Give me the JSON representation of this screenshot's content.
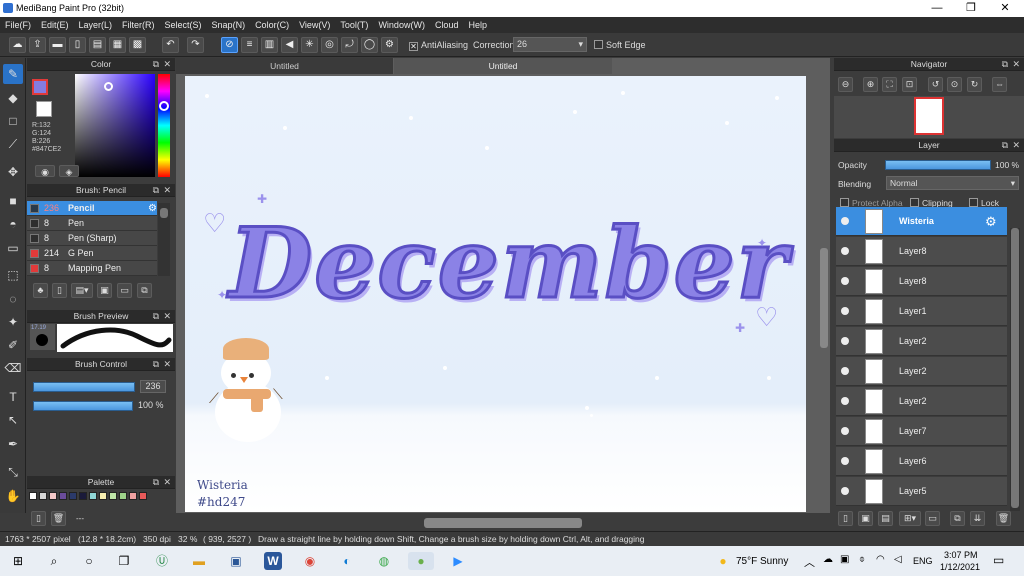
{
  "window": {
    "title": "MediBang Paint Pro (32bit)"
  },
  "menu": [
    "File(F)",
    "Edit(E)",
    "Layer(L)",
    "Filter(R)",
    "Select(S)",
    "Snap(N)",
    "Color(C)",
    "View(V)",
    "Tool(T)",
    "Window(W)",
    "Cloud",
    "Help"
  ],
  "toolbar": {
    "antialiasing_label": "AntiAliasing",
    "correction_label": "Correction",
    "correction_value": "26",
    "soft_edge_label": "Soft Edge"
  },
  "color_panel": {
    "title": "Color",
    "r": "R:132",
    "g": "G:124",
    "b": "B:226",
    "hex": "#847CE2",
    "primary_color": "#847CE2"
  },
  "brush_panel": {
    "title": "Brush: Pencil",
    "items": [
      {
        "size": "236",
        "name": "Pencil",
        "color": "#2a3a4a"
      },
      {
        "size": "8",
        "name": "Pen",
        "color": "#2e2e2e"
      },
      {
        "size": "8",
        "name": "Pen (Sharp)",
        "color": "#2e2e2e"
      },
      {
        "size": "214",
        "name": "G Pen",
        "color": "#e03a3a"
      },
      {
        "size": "8",
        "name": "Mapping Pen",
        "color": "#e03a3a"
      }
    ]
  },
  "brush_preview": {
    "title": "Brush Preview",
    "size": "17.19"
  },
  "brush_control": {
    "title": "Brush Control",
    "size_value": "236",
    "opacity_value": "100 %"
  },
  "palette": {
    "title": "Palette",
    "colors": [
      "#ffffff",
      "#d8d8d8",
      "#f4c8c8",
      "#6b4c9a",
      "#2b3a6b",
      "#1a1a3a",
      "#8fd6d6",
      "#f8efb0",
      "#bfe6a8",
      "#9ed38a",
      "#f0a0a0",
      "#e85a5a"
    ],
    "footer": "---"
  },
  "tabs": [
    "Untitled",
    "Untitled"
  ],
  "artwork": {
    "headline": "December",
    "signature_name": "Wisteria",
    "signature_tag": "#hd247"
  },
  "navigator": {
    "title": "Navigator"
  },
  "layer_panel": {
    "title": "Layer",
    "opacity_label": "Opacity",
    "opacity_value": "100 %",
    "opacity_fraction": 1.0,
    "blending_label": "Blending",
    "blending_value": "Normal",
    "protect_alpha_label": "Protect Alpha",
    "clipping_label": "Clipping",
    "lock_label": "Lock",
    "layers": [
      "Wisteria",
      "Layer8",
      "Layer8",
      "Layer1",
      "Layer2",
      "Layer2",
      "Layer2",
      "Layer7",
      "Layer6",
      "Layer5"
    ]
  },
  "statusbar": {
    "size": "1763 * 2507 pixel",
    "physical": "(12.8 * 18.2cm)",
    "dpi": "350 dpi",
    "zoom": "32 %",
    "coords": "( 939, 2527 )",
    "hint": "Draw a straight line by holding down Shift, Change a brush size by holding down Ctrl, Alt, and dragging"
  },
  "taskbar": {
    "weather": "75°F  Sunny",
    "language": "ENG",
    "time": "3:07 PM",
    "date": "1/12/2021"
  }
}
